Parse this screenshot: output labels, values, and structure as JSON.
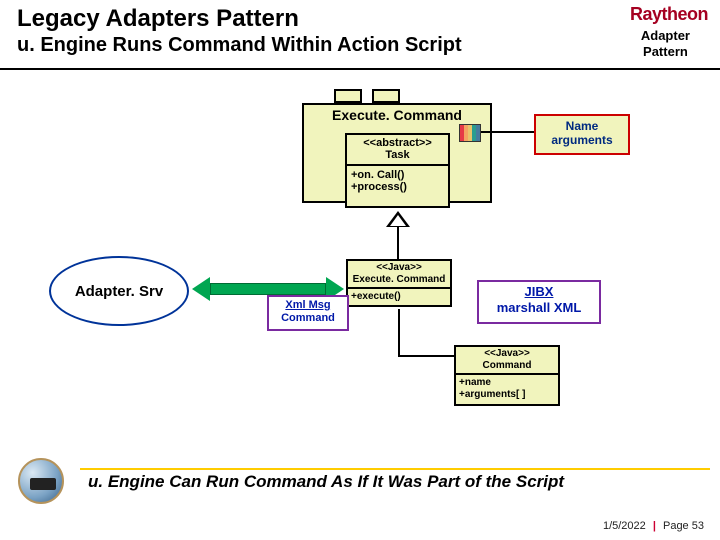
{
  "header": {
    "brand": "Raytheon",
    "title": "Legacy Adapters Pattern",
    "subtitle": "u. Engine Runs Command Within Action Script",
    "adapter_pattern_l1": "Adapter",
    "adapter_pattern_l2": "Pattern"
  },
  "diagram": {
    "execute_command_title": "Execute. Command",
    "task": {
      "stereotype": "<<abstract>>",
      "name": "Task",
      "ops": [
        "+on. Call()",
        "+process()"
      ]
    },
    "name_args": {
      "line1": "Name",
      "line2": "arguments"
    },
    "adapter_srv": "Adapter. Srv",
    "java_execute_command": {
      "stereotype": "<<Java>>",
      "name": "Execute. Command",
      "ops": [
        "+execute()"
      ]
    },
    "xml_msg": {
      "line1": "Xml Msg",
      "line2": "Command"
    },
    "jibx": {
      "line1": "JIBX",
      "line2": "marshall XML"
    },
    "java_command": {
      "stereotype": "<<Java>>",
      "name": "Command",
      "ops": [
        "+name",
        "+arguments[ ]"
      ]
    }
  },
  "summary": "u. Engine Can Run Command As If It Was Part of the Script",
  "footer": {
    "date": "1/5/2022",
    "page_label": "Page",
    "page_number": "53"
  }
}
